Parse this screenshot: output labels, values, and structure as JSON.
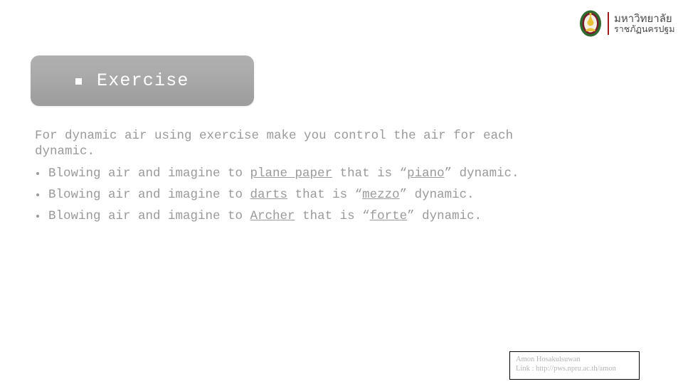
{
  "slide": {
    "background_color": "#ffffff",
    "text_color": "#9a9a9a"
  },
  "logo": {
    "name": "npru-logo",
    "line1": "มหาวิทยาลัย",
    "line2": "ราชภัฏนครปฐม",
    "divider_color": "#9e1b1b",
    "emblem_colors": {
      "ring": "#2f6b2f",
      "inner": "#7a1b2b",
      "figure": "#e8c33a"
    }
  },
  "title": {
    "bullet_glyph": "square-bullet",
    "text": "Exercise",
    "text_color": "#ffffff",
    "plaque_color": "#a8a8a8"
  },
  "body": {
    "intro": "For dynamic air using exercise make you control the air for each dynamic.",
    "bullets": [
      {
        "parts": [
          {
            "text": "Blowing air and imagine to ",
            "underline": false
          },
          {
            "text": "plane paper",
            "underline": true
          },
          {
            "text": " that is “",
            "underline": false
          },
          {
            "text": "piano",
            "underline": true
          },
          {
            "text": "” dynamic.",
            "underline": false
          }
        ]
      },
      {
        "parts": [
          {
            "text": "Blowing air and imagine to ",
            "underline": false
          },
          {
            "text": "darts",
            "underline": true
          },
          {
            "text": " that is “",
            "underline": false
          },
          {
            "text": "mezzo",
            "underline": true
          },
          {
            "text": "” dynamic.",
            "underline": false
          }
        ]
      },
      {
        "parts": [
          {
            "text": "Blowing air and imagine to ",
            "underline": false
          },
          {
            "text": "Archer",
            "underline": true
          },
          {
            "text": " that is “",
            "underline": false
          },
          {
            "text": "forte",
            "underline": true
          },
          {
            "text": "” dynamic.",
            "underline": false
          }
        ]
      }
    ]
  },
  "credit": {
    "author": "Amon Hosakulsuwan",
    "link": "Link : http://pws.npru.ac.th/amon",
    "border_color": "#000000"
  }
}
